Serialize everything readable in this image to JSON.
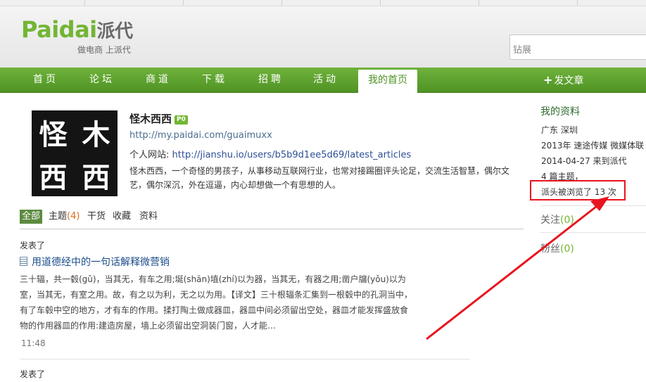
{
  "header": {
    "logo_en": "Paidai",
    "logo_cn": "派代",
    "slogan": "做电商 上派代",
    "search_value": "钻展"
  },
  "nav": {
    "items": [
      "首页",
      "论坛",
      "商道",
      "下载",
      "招聘",
      "活动",
      "我的首页"
    ],
    "post_label": "发文章"
  },
  "profile": {
    "avatar_chars": [
      "怪",
      "木",
      "西",
      "西"
    ],
    "name": "怪木西西",
    "badge": "P0",
    "profile_url": "http://my.paidai.com/guaimuxx",
    "site_label": "个人网站:",
    "site_url": "http://jianshu.io/users/b5b9d1ee5d69/latest_articles",
    "bio": "怪木西西，一个奇怪的男孩子，从事移动互联网行业，也常对接踢圈评头论足，交流生活智慧，偶尔文艺，偶尔深沉，外在逗逼，内心却想做一个有思想的人。"
  },
  "tabs": {
    "all": "全部",
    "topics": "主题",
    "topics_count": "(4)",
    "goods": "干货",
    "favorites": "收藏",
    "info": "资料"
  },
  "feed": {
    "posted_label": "发表了",
    "article_title": "用道德经中的一句话解释微营销",
    "excerpt": "三十辐，共一毂(gǔ)，当其无，有车之用;埏(shān)埴(zhí)以为器，当其无，有器之用;凿户牖(yǒu)以为室，当其无，有室之用。故，有之以为利，无之以为用。【译文】三十根辐条汇集到一根毂中的孔洞当中，有了车毂中空的地方，才有车的作用。揉打陶土做成器皿，器皿中间必须留出空处，器皿才能发挥盛放食物的作用器皿的作用:建造房屋，墙上必须留出空洞装门窗，人才能…",
    "time": "11:48",
    "posted_label_2": "发表了"
  },
  "sidebar": {
    "title": "我的资料",
    "location": "广东 深圳",
    "work": "2013年  速途传媒 微媒体联",
    "joined": "2014-04-27 来到派代",
    "topics": "4 篇主题，",
    "views": "派头被浏览了 13 次",
    "follow_label": "关注",
    "follow_count": "(0)",
    "fans_label": "粉丝",
    "fans_count": "(0)"
  },
  "colors": {
    "brand_green": "#73b534",
    "nav_green": "#5a9e2c",
    "annotation_red": "#e8141e"
  }
}
